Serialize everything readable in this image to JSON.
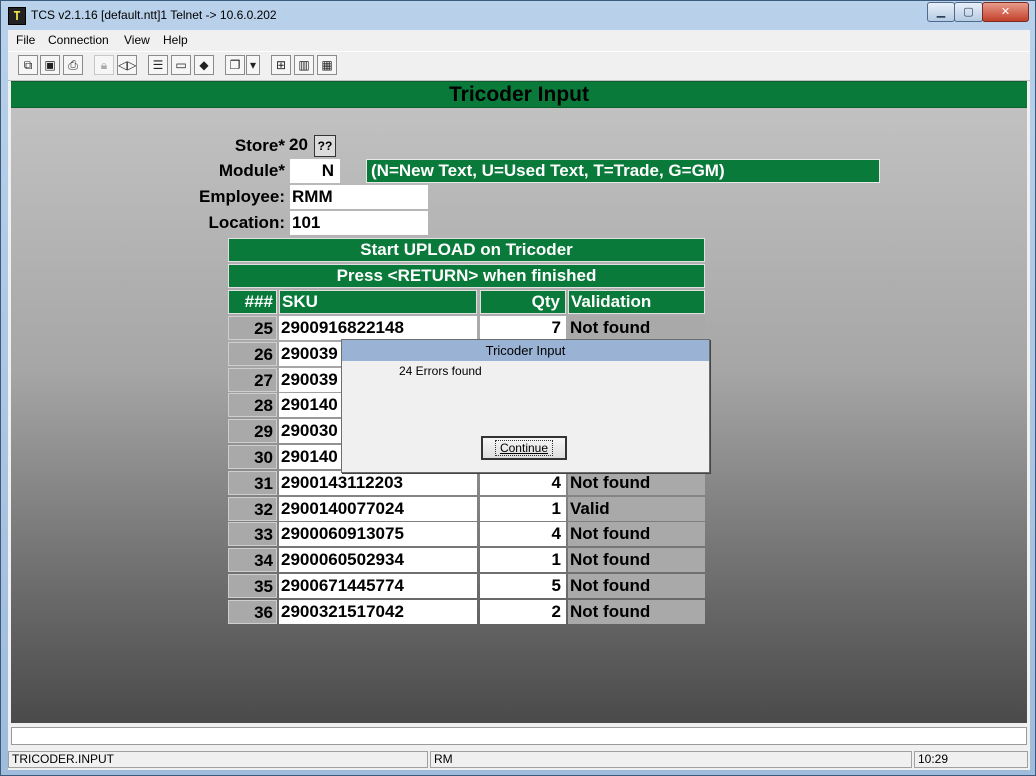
{
  "window": {
    "title": "TCS v2.1.16 [default.ntt]1 Telnet -> 10.6.0.202",
    "icon_text": "T",
    "minimize": "▁",
    "maximize": "▢",
    "close": "✕"
  },
  "menu": [
    "File",
    "Connection",
    "View",
    "Help"
  ],
  "toolbar": {
    "buttons": [
      "copy-icon",
      "save-icon",
      "print-icon",
      "lock-icon",
      "sound-icon",
      "properties-icon",
      "monitor-icon",
      "ticket-icon",
      "pages-icon",
      "dropdown-icon",
      "flowchart-icon",
      "bar-chart-icon",
      "calculator-icon"
    ]
  },
  "screen": {
    "title": "Tricoder Input",
    "store_label": "Store*",
    "store_value": "20",
    "lookup": "??",
    "module_label": "Module*",
    "module_value": "N",
    "module_hint": "(N=New Text, U=Used Text, T=Trade, G=GM)",
    "employee_label": "Employee:",
    "employee_value": "RMM",
    "location_label": "Location:",
    "location_value": "101",
    "banner1": "Start UPLOAD on Tricoder",
    "banner2": "Press <RETURN> when finished",
    "columns": [
      "###",
      "SKU",
      "Qty",
      "Validation"
    ],
    "rows": [
      {
        "num": "25",
        "sku": "2900916822148",
        "qty": "7",
        "val": "Not found"
      },
      {
        "num": "26",
        "sku": "290039",
        "qty": "",
        "val": ""
      },
      {
        "num": "27",
        "sku": "290039",
        "qty": "",
        "val": ""
      },
      {
        "num": "28",
        "sku": "290140",
        "qty": "",
        "val": ""
      },
      {
        "num": "29",
        "sku": "290030",
        "qty": "",
        "val": ""
      },
      {
        "num": "30",
        "sku": "290140",
        "qty": "",
        "val": ""
      },
      {
        "num": "31",
        "sku": "2900143112203",
        "qty": "4",
        "val": "Not found"
      },
      {
        "num": "32",
        "sku": "2900140077024",
        "qty": "1",
        "val": "Valid"
      },
      {
        "num": "33",
        "sku": "2900060913075",
        "qty": "4",
        "val": "Not found"
      },
      {
        "num": "34",
        "sku": "2900060502934",
        "qty": "1",
        "val": "Not found"
      },
      {
        "num": "35",
        "sku": "2900671445774",
        "qty": "5",
        "val": "Not found"
      },
      {
        "num": "36",
        "sku": "2900321517042",
        "qty": "2",
        "val": "Not found"
      }
    ]
  },
  "dialog": {
    "title": "Tricoder Input",
    "message": "24 Errors found",
    "button": "Continue"
  },
  "statusbar": {
    "program": "TRICODER.INPUT",
    "user": "RM",
    "time": "10:29"
  }
}
